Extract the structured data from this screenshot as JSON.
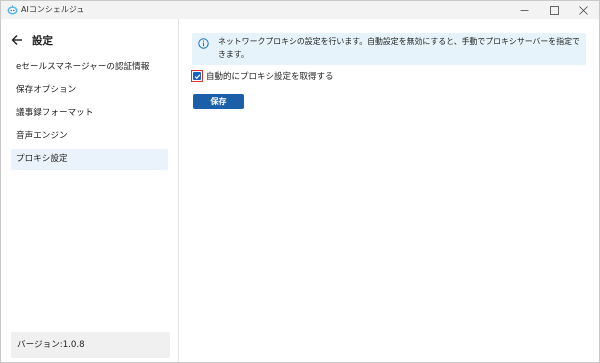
{
  "window": {
    "title": "AIコンシェルジュ"
  },
  "sidebar": {
    "heading": "設定",
    "items": [
      {
        "label": "eセールスマネージャーの認証情報",
        "active": false
      },
      {
        "label": "保存オプション",
        "active": false
      },
      {
        "label": "議事録フォーマット",
        "active": false
      },
      {
        "label": "音声エンジン",
        "active": false
      },
      {
        "label": "プロキシ設定",
        "active": true
      }
    ],
    "version": "バージョン:1.0.8"
  },
  "main": {
    "info_text": "ネットワークプロキシの設定を行います。自動設定を無効にすると、手動でプロキシサーバーを指定できます。",
    "auto_proxy_checkbox": {
      "label": "自動的にプロキシ設定を取得する",
      "checked": true
    },
    "save_label": "保存"
  },
  "colors": {
    "accent": "#1b5fa8",
    "checkbox": "#1565c0",
    "highlight_frame": "#e0322b",
    "info_bg": "#e6f3fb",
    "info_icon": "#1a6fc2",
    "active_nav_bg": "#eaf2fb"
  },
  "icons": {
    "app": "robot-head-icon",
    "back": "arrow-left-icon",
    "info": "info-circle-icon",
    "check": "checkmark-icon"
  }
}
